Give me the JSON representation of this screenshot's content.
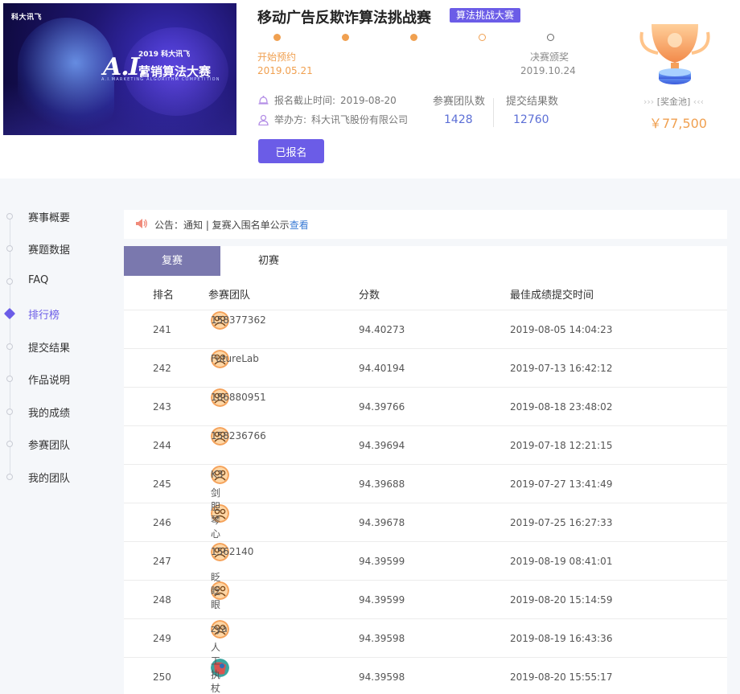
{
  "competition": {
    "title": "移动广告反欺诈算法挑战赛",
    "tag": "算法挑战大赛",
    "banner": {
      "logo": "科大讯飞",
      "year": "2019 科大讯飞",
      "headline_ai": "A.I.",
      "headline_cn": "营销算法大赛",
      "headline_en": "A.I.MARKETING ALGORITHM COMPETITION"
    },
    "timeline": {
      "start_label": "开始预约",
      "start_date": "2019.05.21",
      "end_label": "决赛颁奖",
      "end_date": "2019.10.24",
      "stages": [
        "done",
        "done",
        "done",
        "current",
        "upcoming"
      ]
    },
    "deadline_label": "报名截止时间:",
    "deadline_value": "2019-08-20",
    "organizer_label": "举办方:",
    "organizer_value": "科大讯飞股份有限公司",
    "teams_label": "参赛团队数",
    "teams_value": "1428",
    "submissions_label": "提交结果数",
    "submissions_value": "12760",
    "register_button": "已报名",
    "prize_label": "[奖金池]",
    "prize_value": "￥77,500"
  },
  "sidebar": {
    "items": [
      {
        "label": "赛事概要"
      },
      {
        "label": "赛题数据"
      },
      {
        "label": "FAQ"
      },
      {
        "label": "排行榜"
      },
      {
        "label": "提交结果"
      },
      {
        "label": "作品说明"
      },
      {
        "label": "我的成绩"
      },
      {
        "label": "参赛团队"
      },
      {
        "label": "我的团队"
      }
    ],
    "active_index": 3
  },
  "notice": {
    "text": "公告：通知 | 复赛入围名单公示",
    "link": "查看"
  },
  "tabs": [
    {
      "label": "复赛",
      "active": true
    },
    {
      "label": "初赛",
      "active": false
    }
  ],
  "table": {
    "headers": {
      "rank": "排名",
      "team": "参赛团队",
      "score": "分数",
      "time": "最佳成绩提交时间"
    },
    "rows": [
      {
        "rank": "241",
        "team": "158377362",
        "score": "94.40273",
        "time": "2019-08-05 14:04:23"
      },
      {
        "rank": "242",
        "team": "FutureLab",
        "score": "94.40194",
        "time": "2019-07-13 16:42:12"
      },
      {
        "rank": "243",
        "team": "186880951",
        "score": "94.39766",
        "time": "2019-08-18 23:48:02"
      },
      {
        "rank": "244",
        "team": "158236766",
        "score": "94.39694",
        "time": "2019-07-18 12:21:15"
      },
      {
        "rank": "245",
        "team": "K3",
        "score": "94.39688",
        "time": "2019-07-27 13:41:49"
      },
      {
        "rank": "246",
        "team": "剑胆琴心",
        "score": "94.39678",
        "time": "2019-07-25 16:27:33"
      },
      {
        "rank": "247",
        "team": "1562140",
        "score": "94.39599",
        "time": "2019-08-19 08:41:01"
      },
      {
        "rank": "248",
        "team": "眨眨眼",
        "score": "94.39599",
        "time": "2019-08-20 15:14:59"
      },
      {
        "rank": "249",
        "team": "zya",
        "score": "94.39598",
        "time": "2019-08-19 16:43:36"
      },
      {
        "rank": "250",
        "team": "人工执杖",
        "score": "94.39598",
        "time": "2019-08-20 15:55:17"
      }
    ]
  },
  "colors": {
    "accent": "#6b5ce7",
    "orange": "#f0a050",
    "stat_blue": "#5c6fd6",
    "tab_active": "#7a78ae",
    "link": "#3a7bd5"
  }
}
